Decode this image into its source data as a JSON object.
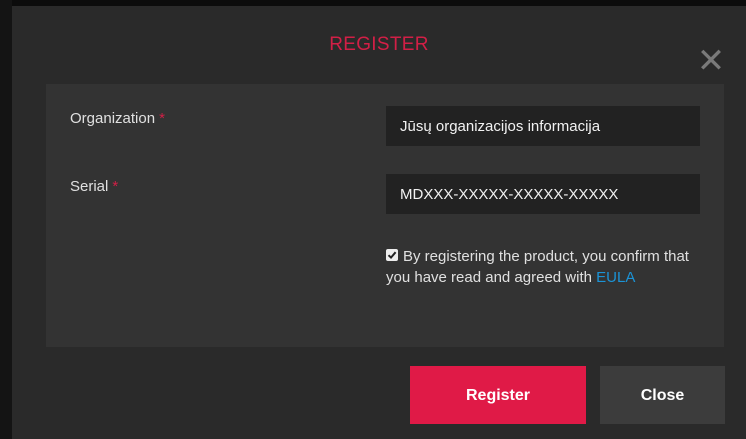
{
  "dialog": {
    "title": "REGISTER",
    "close_glyph": "✕"
  },
  "form": {
    "organization": {
      "label": "Organization",
      "required_mark": "*",
      "value": "Jūsų organizacijos informacija"
    },
    "serial": {
      "label": "Serial",
      "required_mark": "*",
      "value": "MDXXX-XXXXX-XXXXX-XXXXX"
    },
    "agreement": {
      "checked": true,
      "text": "By registering the product, you confirm that you have read and agreed with",
      "link_label": "EULA"
    }
  },
  "buttons": {
    "register_label": "Register",
    "close_label": "Close"
  },
  "colors": {
    "accent": "#e01a47",
    "title": "#d21f46",
    "link": "#1b93d6",
    "panel": "#333333",
    "modal": "#2a2a2a"
  },
  "icons": {
    "close": "close-icon",
    "checkbox": "checkmark-icon"
  }
}
